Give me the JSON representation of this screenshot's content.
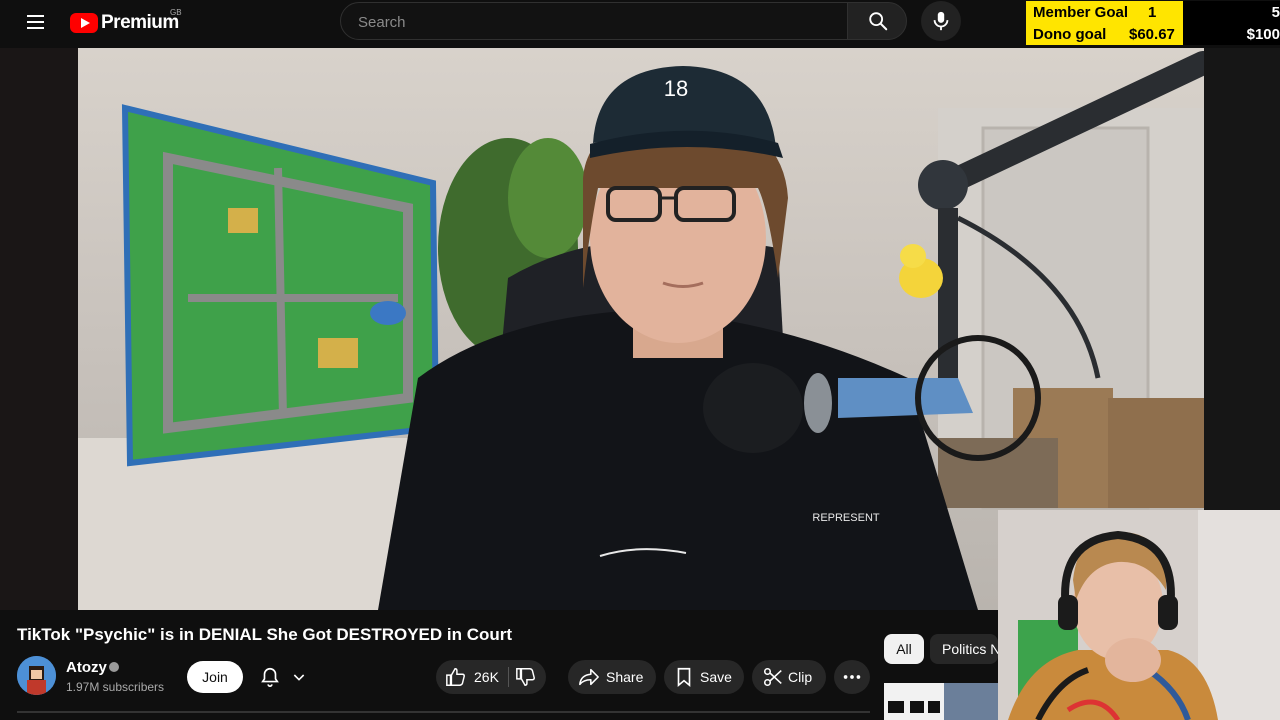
{
  "header": {
    "logo_text": "Premium",
    "country_code": "GB",
    "search_placeholder": "Search"
  },
  "goal_overlay": {
    "member_goal": {
      "label": "Member Goal",
      "current": "1",
      "target": "5",
      "progress": 0.2
    },
    "dono_goal": {
      "label": "Dono goal",
      "current": "$60.67",
      "target": "$100",
      "progress": 0.6067
    }
  },
  "video": {
    "title": "TikTok \"Psychic\" is in DENIAL She Got DESTROYED in Court"
  },
  "channel": {
    "name": "Atozy",
    "subscribers": "1.97M subscribers",
    "join_label": "Join"
  },
  "actions": {
    "likes": "26K",
    "share_label": "Share",
    "save_label": "Save",
    "clip_label": "Clip"
  },
  "chips": {
    "all": "All",
    "politics": "Politics N"
  },
  "colors": {
    "brand": "#ff0000",
    "goal_fill": "#ffe500",
    "background": "#0f0f0f"
  }
}
